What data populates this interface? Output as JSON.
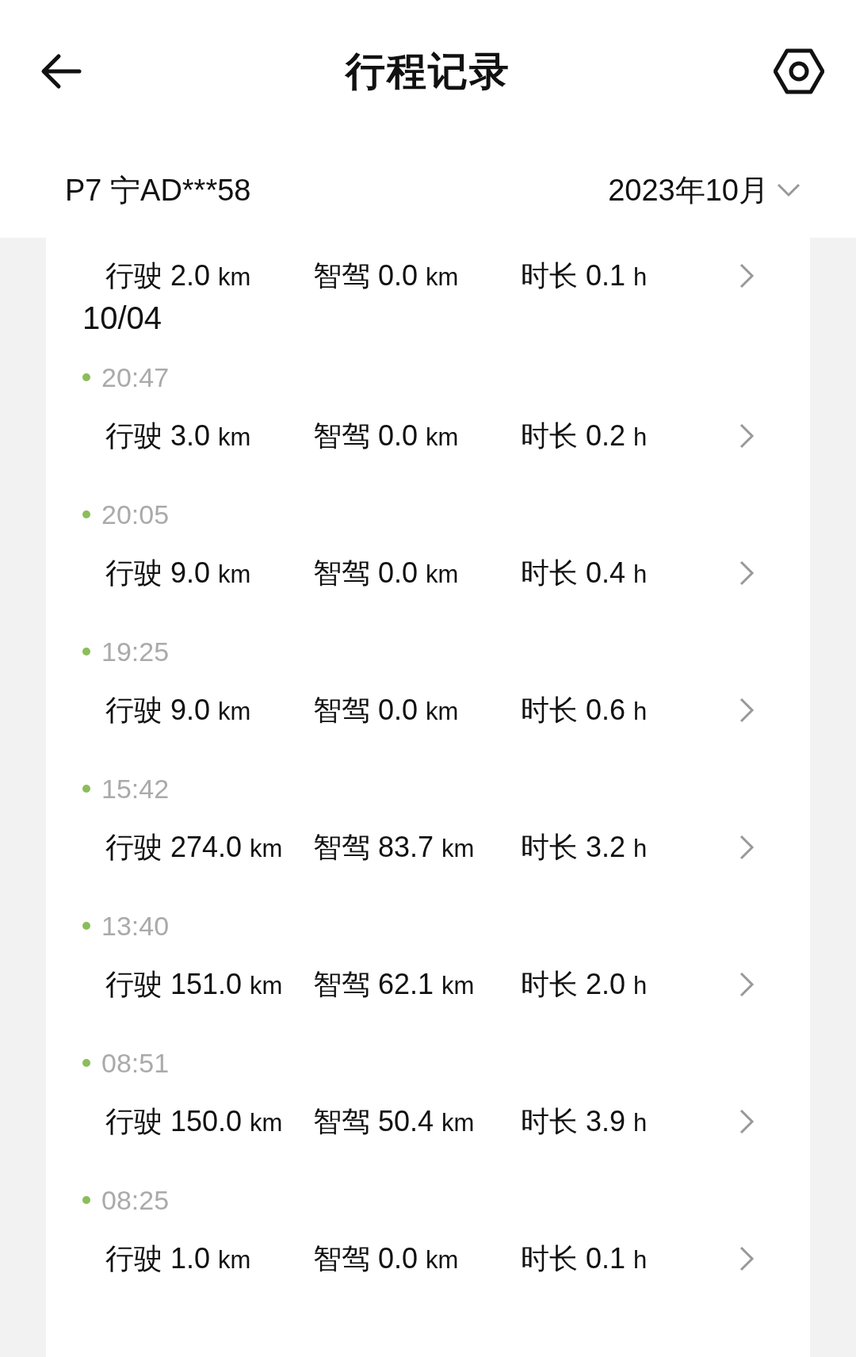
{
  "header": {
    "title": "行程记录"
  },
  "vehicle": {
    "name": "P7 宁AD***58",
    "month": "2023年10月"
  },
  "partial_trip": {
    "stats": [
      {
        "label": "行驶",
        "value": "2.0",
        "unit": "km"
      },
      {
        "label": "智驾",
        "value": "0.0",
        "unit": "km"
      },
      {
        "label": "时长",
        "value": "0.1",
        "unit": "h"
      }
    ]
  },
  "day": {
    "date": "10/04",
    "trips": [
      {
        "time": "20:47",
        "stats": [
          {
            "label": "行驶",
            "value": "3.0",
            "unit": "km"
          },
          {
            "label": "智驾",
            "value": "0.0",
            "unit": "km"
          },
          {
            "label": "时长",
            "value": "0.2",
            "unit": "h"
          }
        ]
      },
      {
        "time": "20:05",
        "stats": [
          {
            "label": "行驶",
            "value": "9.0",
            "unit": "km"
          },
          {
            "label": "智驾",
            "value": "0.0",
            "unit": "km"
          },
          {
            "label": "时长",
            "value": "0.4",
            "unit": "h"
          }
        ]
      },
      {
        "time": "19:25",
        "stats": [
          {
            "label": "行驶",
            "value": "9.0",
            "unit": "km"
          },
          {
            "label": "智驾",
            "value": "0.0",
            "unit": "km"
          },
          {
            "label": "时长",
            "value": "0.6",
            "unit": "h"
          }
        ]
      },
      {
        "time": "15:42",
        "stats": [
          {
            "label": "行驶",
            "value": "274.0",
            "unit": "km"
          },
          {
            "label": "智驾",
            "value": "83.7",
            "unit": "km"
          },
          {
            "label": "时长",
            "value": "3.2",
            "unit": "h"
          }
        ]
      },
      {
        "time": "13:40",
        "stats": [
          {
            "label": "行驶",
            "value": "151.0",
            "unit": "km"
          },
          {
            "label": "智驾",
            "value": "62.1",
            "unit": "km"
          },
          {
            "label": "时长",
            "value": "2.0",
            "unit": "h"
          }
        ]
      },
      {
        "time": "08:51",
        "stats": [
          {
            "label": "行驶",
            "value": "150.0",
            "unit": "km"
          },
          {
            "label": "智驾",
            "value": "50.4",
            "unit": "km"
          },
          {
            "label": "时长",
            "value": "3.9",
            "unit": "h"
          }
        ]
      },
      {
        "time": "08:25",
        "stats": [
          {
            "label": "行驶",
            "value": "1.0",
            "unit": "km"
          },
          {
            "label": "智驾",
            "value": "0.0",
            "unit": "km"
          },
          {
            "label": "时长",
            "value": "0.1",
            "unit": "h"
          }
        ]
      }
    ]
  }
}
